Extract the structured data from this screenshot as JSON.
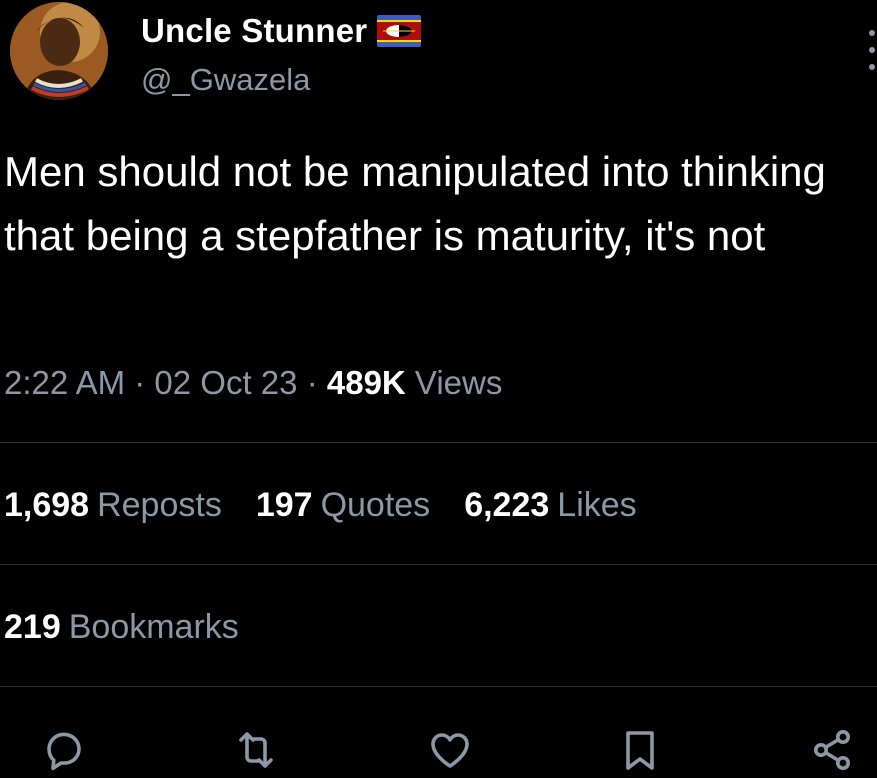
{
  "author": {
    "display_name": "Uncle Stunner",
    "handle": "@_Gwazela",
    "flag_icon": "eswatini-flag-icon",
    "avatar_icon": "profile-photo"
  },
  "tweet": {
    "text": "Men should not be manipulated into thinking that being a stepfather is maturity, it's not",
    "time": "2:22 AM",
    "date": "02 Oct 23",
    "views_count": "489K",
    "views_label": "Views",
    "separator": "·"
  },
  "stats": {
    "reposts_count": "1,698",
    "reposts_label": "Reposts",
    "quotes_count": "197",
    "quotes_label": "Quotes",
    "likes_count": "6,223",
    "likes_label": "Likes",
    "bookmarks_count": "219",
    "bookmarks_label": "Bookmarks"
  },
  "actions": {
    "reply": "reply-icon",
    "repost": "repost-icon",
    "like": "heart-icon",
    "bookmark": "bookmark-icon",
    "share": "share-icon",
    "more": "more-vertical-icon"
  },
  "colors": {
    "background": "#000000",
    "primary_text": "#ffffff",
    "secondary_text": "#8b98a5",
    "divider": "#2f3336"
  }
}
